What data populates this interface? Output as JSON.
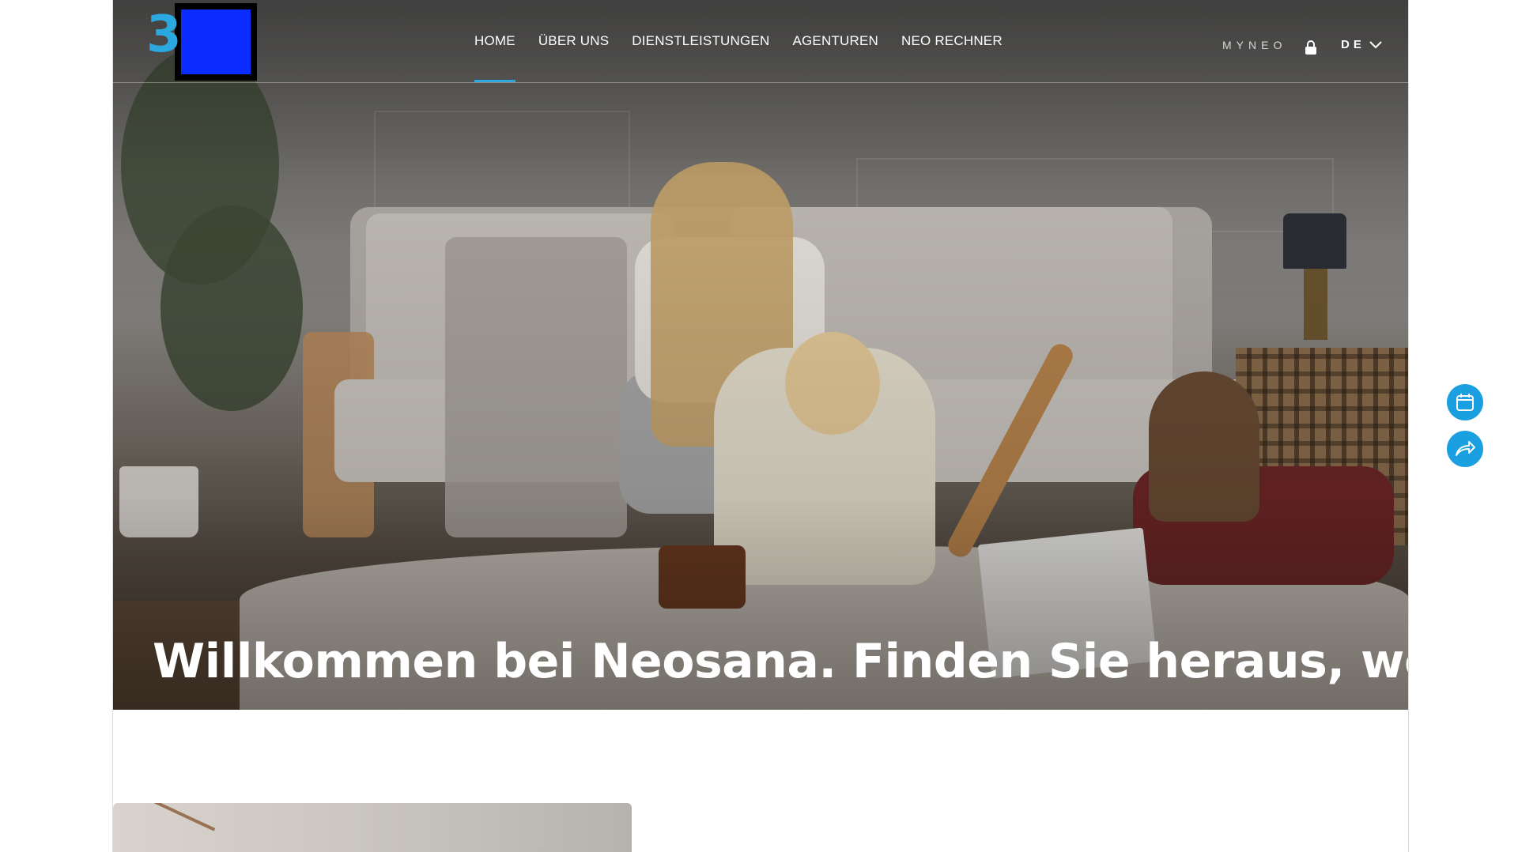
{
  "header": {
    "nav": [
      {
        "label": "HOME",
        "active": true
      },
      {
        "label": "ÜBER UNS",
        "active": false
      },
      {
        "label": "DIENSTLEISTUNGEN",
        "active": false
      },
      {
        "label": "AGENTUREN",
        "active": false
      },
      {
        "label": "NEO RECHNER",
        "active": false
      }
    ],
    "myneo_label": "MYNEO",
    "language": "DE",
    "logo_digit": "3"
  },
  "hero": {
    "title": "Willkommen bei Neosana. Finden Sie heraus, wer wir sind."
  },
  "floating_actions": [
    {
      "icon": "calendar-icon"
    },
    {
      "icon": "share-icon"
    }
  ],
  "colors": {
    "accent": "#2aa8df",
    "logo_blue": "#0a2cff",
    "float_button": "#1a9fe0"
  }
}
